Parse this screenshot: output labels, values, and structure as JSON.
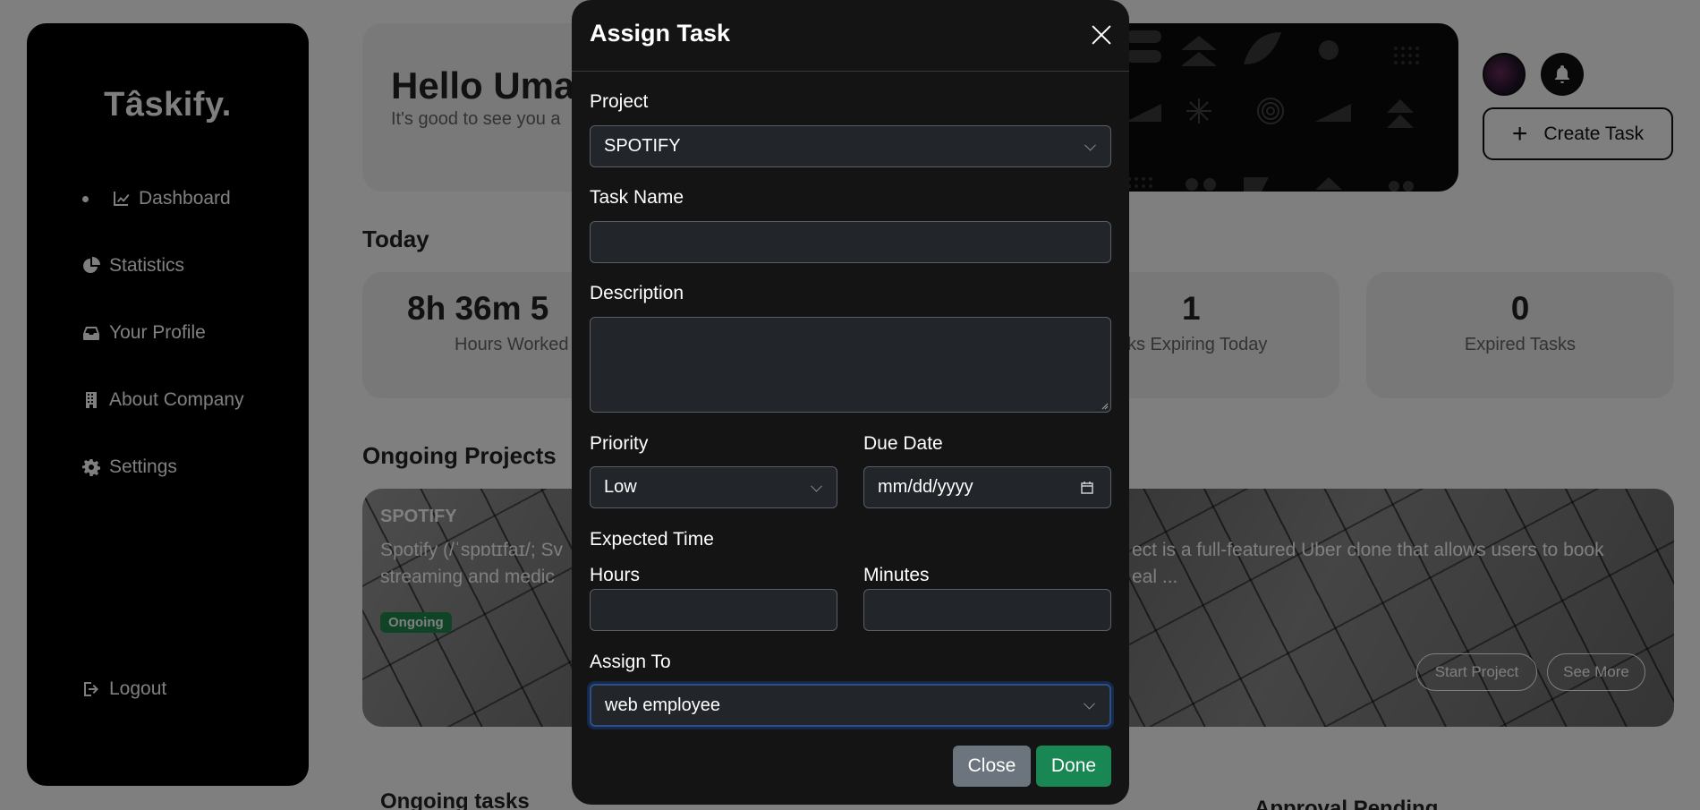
{
  "sidebar": {
    "brand": "Tâskify.",
    "items": [
      {
        "label": "Dashboard"
      },
      {
        "label": "Statistics"
      },
      {
        "label": "Your Profile"
      },
      {
        "label": "About Company"
      },
      {
        "label": "Settings"
      }
    ],
    "logout": "Logout"
  },
  "hero": {
    "greeting": "Hello Uma",
    "subtitle": "It's good to see you a"
  },
  "header": {
    "create_task": "Create Task"
  },
  "today": {
    "title": "Today",
    "stats": [
      {
        "value": "8h 36m 5",
        "label": "Hours Worked"
      },
      {
        "value": "1",
        "label": "ks Expiring Today"
      },
      {
        "value": "0",
        "label": "Expired Tasks"
      }
    ]
  },
  "projects": {
    "title": "Ongoing Projects",
    "card": {
      "name": "SPOTIFY",
      "desc_line1_left": "Spotify (/ˈspɒtɪfaɪ/; Sv",
      "desc_line1_right": "ect is a full-featured Uber clone that allows users to book",
      "desc_line2_left": "streaming and medic",
      "desc_line2_right": "eal ...",
      "status": "Ongoing",
      "start_btn": "Start Project",
      "see_more_btn": "See More"
    }
  },
  "bottom": {
    "ongoing_tasks": "Ongoing tasks",
    "approval_pending": "Approval Pending"
  },
  "modal": {
    "title": "Assign Task",
    "project_label": "Project",
    "project_value": "SPOTIFY",
    "task_name_label": "Task Name",
    "task_name_value": "",
    "description_label": "Description",
    "description_value": "",
    "priority_label": "Priority",
    "priority_value": "Low",
    "due_date_label": "Due Date",
    "due_date_placeholder": "mm/dd/yyyy",
    "expected_time_label": "Expected Time",
    "hours_label": "Hours",
    "hours_value": "",
    "minutes_label": "Minutes",
    "minutes_value": "",
    "assign_to_label": "Assign To",
    "assign_to_value": "web employee",
    "close_btn": "Close",
    "done_btn": "Done",
    "colors": {
      "close": "#6c757d",
      "done": "#198754"
    }
  }
}
